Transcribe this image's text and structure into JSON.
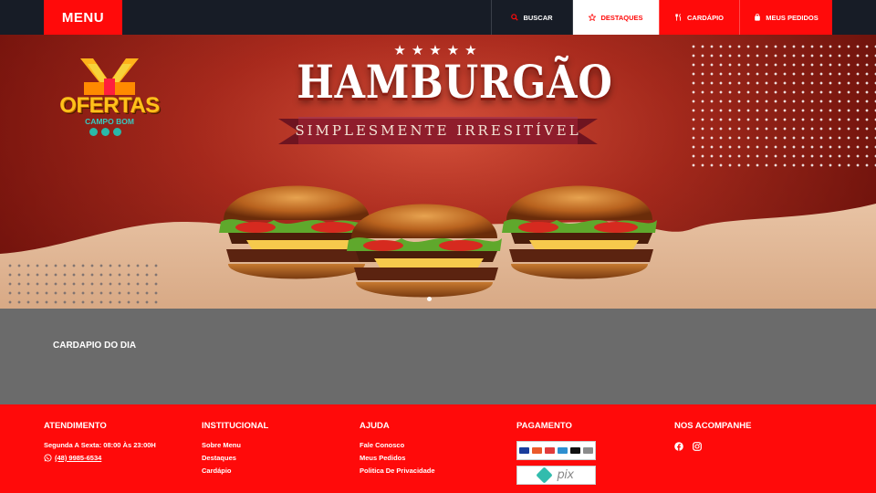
{
  "nav": {
    "menu_label": "MENU",
    "items": [
      {
        "label": "BUSCAR",
        "icon": "search-icon"
      },
      {
        "label": "DESTAQUES",
        "icon": "star-icon"
      },
      {
        "label": "CARDÁPIO",
        "icon": "cutlery-icon"
      },
      {
        "label": "MEUS PEDIDOS",
        "icon": "bag-icon"
      }
    ]
  },
  "hero": {
    "logo_title": "OFERTAS",
    "logo_subtitle": "CAMPO BOM",
    "headline": "HAMBURGÃO",
    "tagline": "SIMPLESMENTE IRRESITÍVEL",
    "stars": "★★★★★"
  },
  "daily": {
    "title": "CARDAPIO DO DIA"
  },
  "footer": {
    "atendimento": {
      "heading": "ATENDIMENTO",
      "hours": "Segunda A Sexta: 08:00 Às 23:00H",
      "phone": "(48) 9985-6534"
    },
    "institucional": {
      "heading": "INSTITUCIONAL",
      "links": [
        "Sobre Menu",
        "Destaques",
        "Cardápio"
      ]
    },
    "ajuda": {
      "heading": "AJUDA",
      "links": [
        "Fale Conosco",
        "Meus Pedidos",
        "Politica De Privacidade"
      ]
    },
    "pagamento": {
      "heading": "PAGAMENTO",
      "pix_label": "pix"
    },
    "social": {
      "heading": "NOS ACOMPANHE",
      "icons": [
        "facebook-icon",
        "instagram-icon"
      ]
    }
  },
  "colors": {
    "brand_red": "#ff0a0a",
    "nav_dark": "#171c26",
    "section_gray": "#6b6b6b",
    "logo_gold": "#ffc21a",
    "logo_teal": "#38c9c0"
  }
}
